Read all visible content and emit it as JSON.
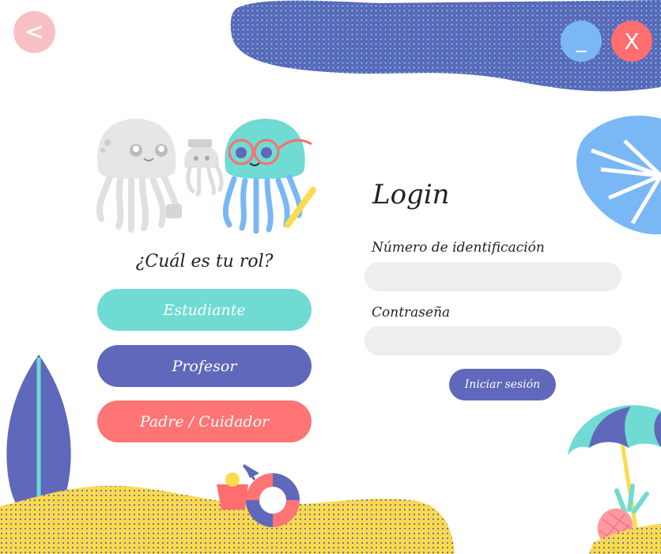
{
  "window_controls": {
    "back": "<",
    "minimize": "_",
    "close": "X"
  },
  "roles": {
    "question": "¿Cuál es tu rol?",
    "student": "Estudiante",
    "teacher": "Profesor",
    "parent": "Padre / Cuidador"
  },
  "login": {
    "title": "Login",
    "id_label": "Número de identificación",
    "id_value": "",
    "password_label": "Contraseña",
    "password_value": "",
    "submit": "Iniciar sesión"
  },
  "colors": {
    "teal": "#6fdbd3",
    "indigo": "#5f68bb",
    "coral": "#ff7474",
    "pink": "#f9c0c4",
    "sky": "#7ab8f5",
    "sand": "#fddb4c"
  }
}
